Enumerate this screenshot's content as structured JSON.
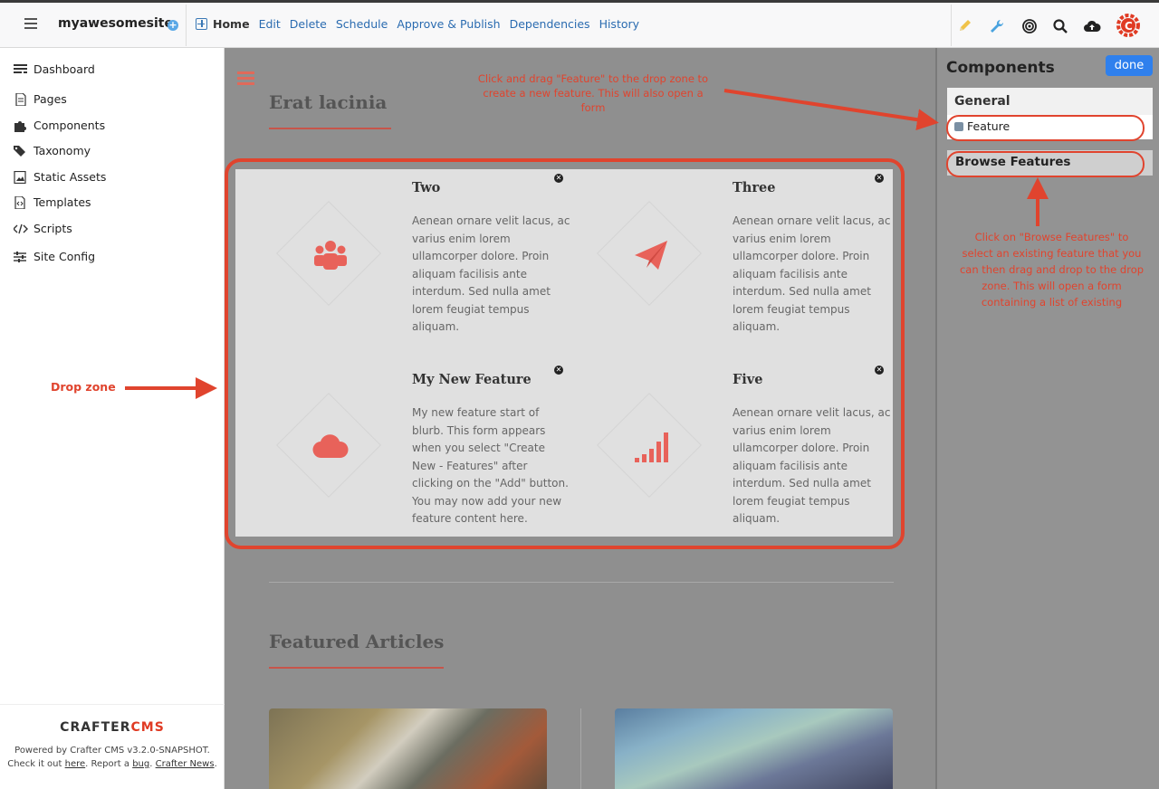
{
  "topbar": {
    "site_name": "myawesomesite",
    "nav": [
      "Home",
      "Edit",
      "Delete",
      "Schedule",
      "Approve & Publish",
      "Dependencies",
      "History"
    ],
    "icons": [
      "pencil-icon",
      "wrench-icon",
      "target-icon",
      "search-icon",
      "cloud-upload-icon",
      "crafter-logo-icon"
    ]
  },
  "sidebar": {
    "items": [
      {
        "label": "Dashboard",
        "icon": "dashboard-icon"
      },
      {
        "label": "Pages",
        "icon": "page-icon"
      },
      {
        "label": "Components",
        "icon": "puzzle-icon"
      },
      {
        "label": "Taxonomy",
        "icon": "tags-icon"
      },
      {
        "label": "Static Assets",
        "icon": "image-icon"
      },
      {
        "label": "Templates",
        "icon": "code-file-icon"
      },
      {
        "label": "Scripts",
        "icon": "code-icon"
      },
      {
        "label": "Site Config",
        "icon": "sliders-icon"
      }
    ],
    "footer": {
      "logo_a": "CRAFTER",
      "logo_b": "CMS",
      "powered": "Powered by Crafter CMS v3.2.0-SNAPSHOT.",
      "check": "Check it out",
      "here": "here",
      "report": ". Report a",
      "bug": "bug",
      "dot": ".",
      "news": "Crafter News",
      "end": "."
    }
  },
  "preview": {
    "title": "Erat lacinia",
    "features": [
      {
        "title": "Two",
        "body": "Aenean ornare velit lacus, ac varius enim lorem ullamcorper dolore. Proin aliquam facilisis ante interdum. Sed nulla amet lorem feugiat tempus aliquam.",
        "icon": "users-icon"
      },
      {
        "title": "Three",
        "body": "Aenean ornare velit lacus, ac varius enim lorem ullamcorper dolore. Proin aliquam facilisis ante interdum. Sed nulla amet lorem feugiat tempus aliquam.",
        "icon": "paper-plane-icon"
      },
      {
        "title": "My New Feature",
        "body": "My new feature start of blurb.  This form appears when you select \"Create New - Features\" after clicking on the \"Add\" button.  You may now add your new feature content here.",
        "icon": "cloud-icon"
      },
      {
        "title": "Five",
        "body": "Aenean ornare velit lacus, ac varius enim lorem ullamcorper dolore. Proin aliquam facilisis ante interdum. Sed nulla amet lorem feugiat tempus aliquam.",
        "icon": "signal-icon"
      }
    ],
    "featured_title": "Featured Articles"
  },
  "annotations": {
    "drag": "Click and drag \"Feature\" to the drop zone to create a new feature.  This will also open a form",
    "browse": "Click on \"Browse Features\" to select an existing feature that you can then drag and drop to the drop zone.  This will open a form containing a list of existing",
    "drop_zone": "Drop zone"
  },
  "panel": {
    "title": "Components",
    "done": "done",
    "general": "General",
    "feature": "Feature",
    "browse": "Browse Features"
  },
  "colors": {
    "accent": "#e0442e",
    "link": "#2a6bb0",
    "primary_button": "#2f80ed"
  }
}
